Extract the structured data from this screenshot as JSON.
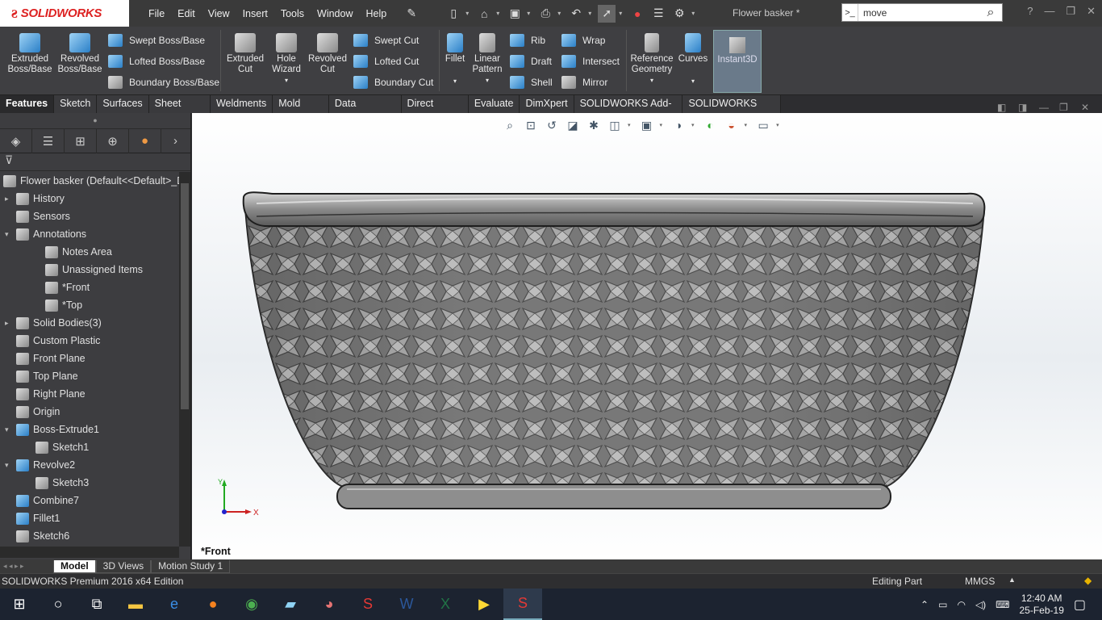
{
  "app": {
    "brand": "SOLIDWORKS",
    "doc_title": "Flower basker *"
  },
  "menu": [
    "File",
    "Edit",
    "View",
    "Insert",
    "Tools",
    "Window",
    "Help"
  ],
  "search": {
    "value": "move"
  },
  "ribbon": {
    "extruded_boss": "Extruded Boss/Base",
    "revolved_boss": "Revolved Boss/Base",
    "swept_boss": "Swept Boss/Base",
    "lofted_boss": "Lofted Boss/Base",
    "boundary_boss": "Boundary Boss/Base",
    "extruded_cut": "Extruded Cut",
    "hole_wizard": "Hole Wizard",
    "revolved_cut": "Revolved Cut",
    "swept_cut": "Swept Cut",
    "lofted_cut": "Lofted Cut",
    "boundary_cut": "Boundary Cut",
    "fillet": "Fillet",
    "linear_pattern": "Linear Pattern",
    "rib": "Rib",
    "draft": "Draft",
    "shell": "Shell",
    "wrap": "Wrap",
    "intersect": "Intersect",
    "mirror": "Mirror",
    "reference_geometry": "Reference Geometry",
    "curves": "Curves",
    "instant3d": "Instant3D"
  },
  "command_tabs": [
    "Features",
    "Sketch",
    "Surfaces",
    "Sheet Metal",
    "Weldments",
    "Mold Tools",
    "Data Migration",
    "Direct Editing",
    "Evaluate",
    "DimXpert",
    "SOLIDWORKS Add-Ins",
    "SOLIDWORKS MBD"
  ],
  "tree": {
    "root": "Flower basker  (Default<<Default>_Di",
    "items": [
      {
        "label": "History",
        "toggle": "▸"
      },
      {
        "label": "Sensors",
        "toggle": ""
      },
      {
        "label": "Annotations",
        "toggle": "▾"
      },
      {
        "label": "Notes Area",
        "toggle": ""
      },
      {
        "label": "Unassigned Items",
        "toggle": ""
      },
      {
        "label": "*Front",
        "toggle": ""
      },
      {
        "label": "*Top",
        "toggle": ""
      },
      {
        "label": "Solid Bodies(3)",
        "toggle": "▸"
      },
      {
        "label": "Custom Plastic",
        "toggle": ""
      },
      {
        "label": "Front Plane",
        "toggle": ""
      },
      {
        "label": "Top Plane",
        "toggle": ""
      },
      {
        "label": "Right Plane",
        "toggle": ""
      },
      {
        "label": "Origin",
        "toggle": ""
      },
      {
        "label": "Boss-Extrude1",
        "toggle": "▾"
      },
      {
        "label": "Sketch1",
        "toggle": ""
      },
      {
        "label": "Revolve2",
        "toggle": "▾"
      },
      {
        "label": "Sketch3",
        "toggle": ""
      },
      {
        "label": "Combine7",
        "toggle": ""
      },
      {
        "label": "Fillet1",
        "toggle": ""
      },
      {
        "label": "Sketch6",
        "toggle": ""
      }
    ]
  },
  "viewport": {
    "view_label": "*Front",
    "triad_x": "X",
    "triad_y": "Y"
  },
  "bottom_tabs": [
    "Model",
    "3D Views",
    "Motion Study 1"
  ],
  "status": {
    "left": "SOLIDWORKS Premium 2016 x64 Edition",
    "mode": "Editing Part",
    "units": "MMGS"
  },
  "taskbar": {
    "time": "12:40 AM",
    "date": "25-Feb-19"
  }
}
